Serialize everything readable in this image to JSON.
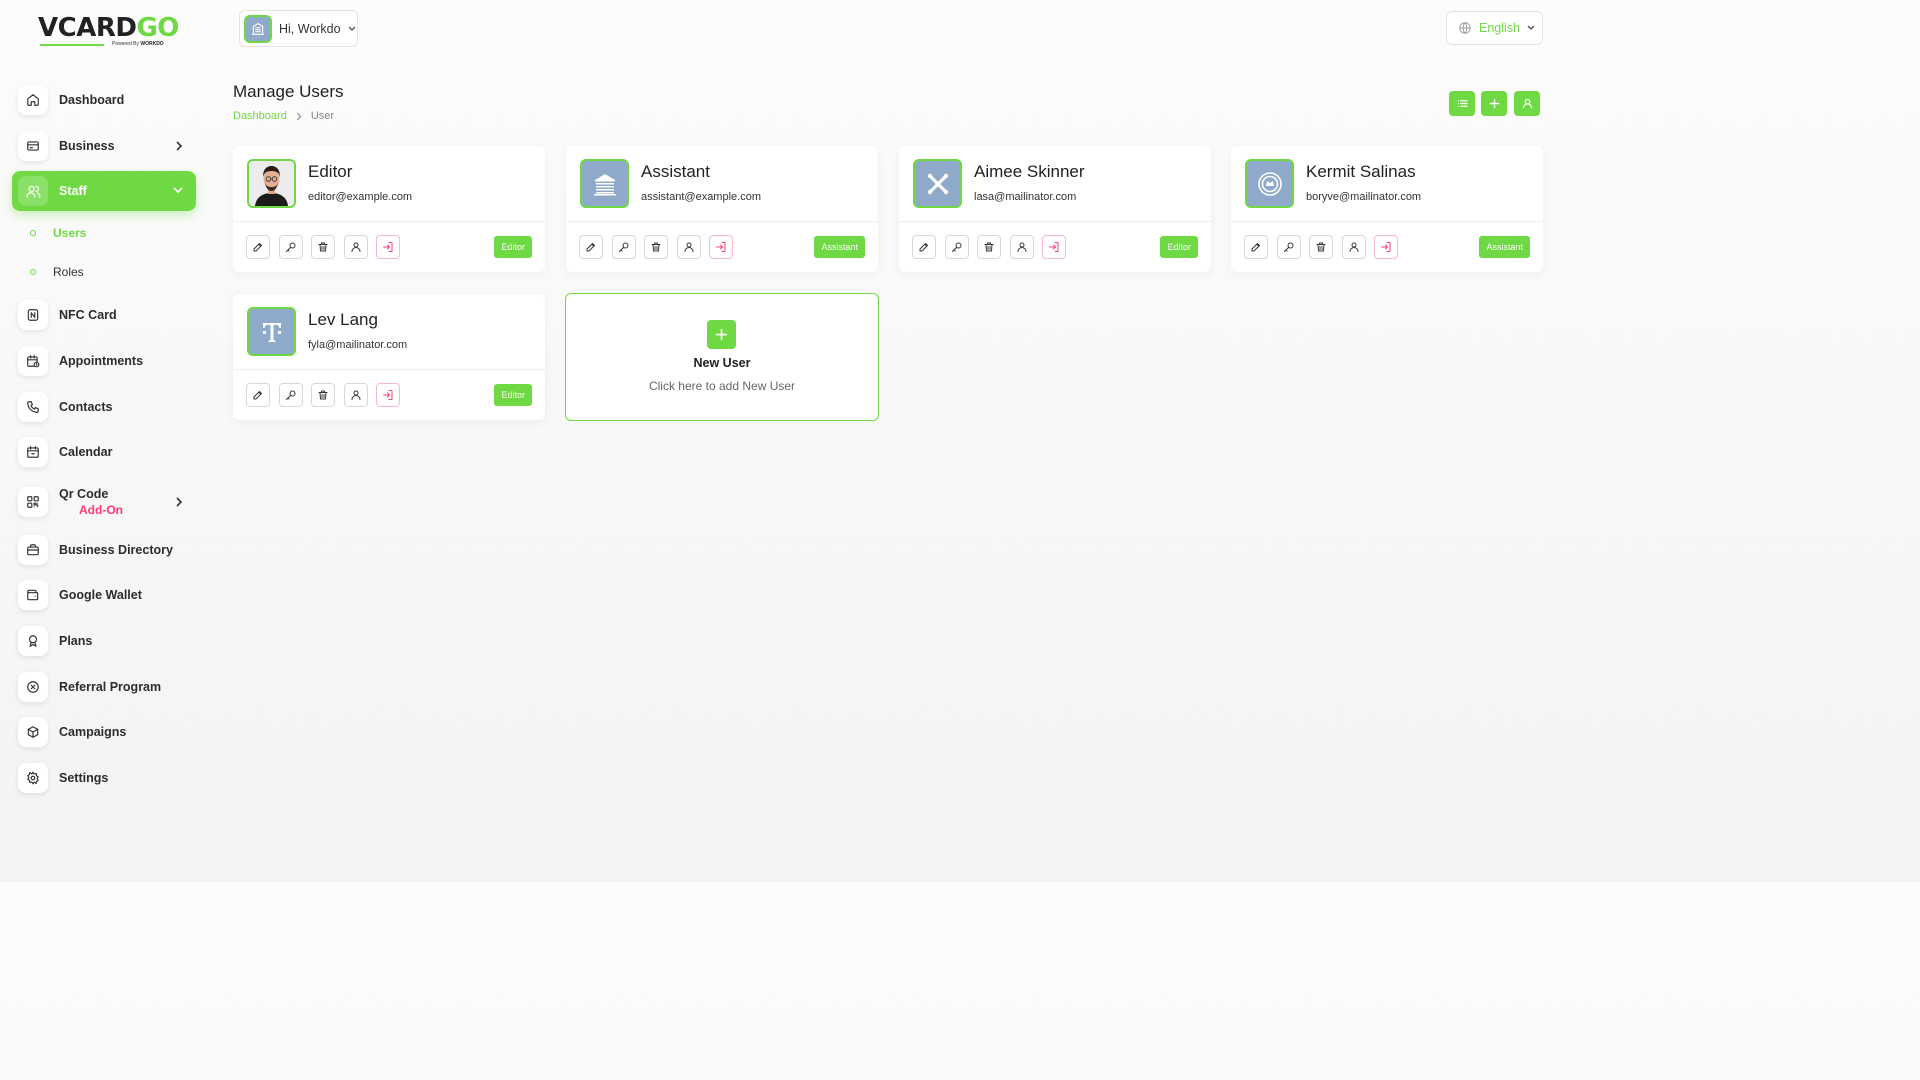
{
  "brand": {
    "logo_main": "VCARD",
    "logo_accent": "GO",
    "logo_sub_prefix": "Powered By",
    "logo_sub_brand": "WORKDO",
    "accent_color": "#6fd943",
    "danger_color": "#ff3a6e"
  },
  "sidebar": {
    "items": [
      {
        "label": "Dashboard",
        "icon": "home-icon"
      },
      {
        "label": "Business",
        "icon": "business-icon"
      },
      {
        "label": "Staff",
        "icon": "staff-icon"
      },
      {
        "label": "NFC Card",
        "icon": "nfc-icon"
      },
      {
        "label": "Appointments",
        "icon": "appointments-icon"
      },
      {
        "label": "Contacts",
        "icon": "phone-icon"
      },
      {
        "label": "Calendar",
        "icon": "calendar-icon"
      },
      {
        "label": "Qr Code",
        "icon": "qr-icon",
        "badge": "Add-On"
      },
      {
        "label": "Business Directory",
        "icon": "briefcase-icon"
      },
      {
        "label": "Google Wallet",
        "icon": "wallet-icon"
      },
      {
        "label": "Plans",
        "icon": "award-icon"
      },
      {
        "label": "Referral Program",
        "icon": "referral-icon"
      },
      {
        "label": "Campaigns",
        "icon": "box-icon"
      },
      {
        "label": "Settings",
        "icon": "gear-icon"
      }
    ],
    "staff_sub": [
      {
        "label": "Users",
        "active": true
      },
      {
        "label": "Roles",
        "active": false
      }
    ]
  },
  "header": {
    "greeting": "Hi, Workdo",
    "language": "English"
  },
  "page": {
    "title": "Manage Users",
    "breadcrumb_home": "Dashboard",
    "breadcrumb_current": "User"
  },
  "users": [
    {
      "name": "Editor",
      "email": "editor@example.com",
      "role": "Editor",
      "avatar": "photo"
    },
    {
      "name": "Assistant",
      "email": "assistant@example.com",
      "role": "Assistant",
      "avatar": "building"
    },
    {
      "name": "Aimee Skinner",
      "email": "lasa@mailinator.com",
      "role": "Editor",
      "avatar": "joomla"
    },
    {
      "name": "Kermit Salinas",
      "email": "boryve@mailinator.com",
      "role": "Assistant",
      "avatar": "seal"
    },
    {
      "name": "Lev Lang",
      "email": "fyla@mailinator.com",
      "role": "Editor",
      "avatar": "t-logo"
    }
  ],
  "new_user": {
    "title": "New User",
    "subtitle": "Click here to add New User"
  }
}
